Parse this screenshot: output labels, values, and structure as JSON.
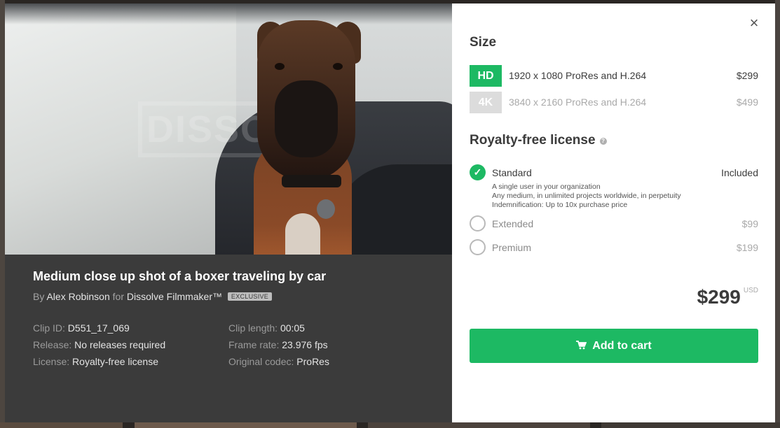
{
  "clip": {
    "title": "Medium close up shot of a boxer traveling by car",
    "by_label": "By",
    "author": "Alex Robinson",
    "for_label": "for",
    "studio": "Dissolve Filmmaker™",
    "badge": "EXCLUSIVE",
    "watermark": "DISSOLVE",
    "meta_left": [
      {
        "label": "Clip ID:",
        "value": "D551_17_069"
      },
      {
        "label": "Release:",
        "value": "No releases required"
      },
      {
        "label": "License:",
        "value": "Royalty-free license"
      }
    ],
    "meta_right": [
      {
        "label": "Clip length:",
        "value": "00:05"
      },
      {
        "label": "Frame rate:",
        "value": "23.976 fps"
      },
      {
        "label": "Original codec:",
        "value": "ProRes"
      }
    ]
  },
  "panel": {
    "close_icon": "×",
    "size_heading": "Size",
    "sizes": [
      {
        "badge": "HD",
        "desc": "1920 x 1080  ProRes and H.264",
        "price": "$299",
        "selected": true
      },
      {
        "badge": "4K",
        "desc": "3840 x 2160  ProRes and H.264",
        "price": "$499",
        "selected": false
      }
    ],
    "license_heading": "Royalty-free license",
    "help_icon": "?",
    "licenses": [
      {
        "name": "Standard",
        "price": "Included",
        "selected": true,
        "details": [
          "A single user in your organization",
          "Any medium, in unlimited projects worldwide, in perpetuity",
          "Indemnification: Up to 10x purchase price"
        ]
      },
      {
        "name": "Extended",
        "price": "$99",
        "selected": false
      },
      {
        "name": "Premium",
        "price": "$199",
        "selected": false
      }
    ],
    "total": "$299",
    "currency": "USD",
    "cart_label": "Add to cart",
    "cart_icon": "🛒"
  },
  "colors": {
    "green": "#1db963",
    "disabled_badge": "#dcdcdc",
    "text_dark": "#3b3b3b",
    "text_disabled": "#a9a9a9"
  }
}
